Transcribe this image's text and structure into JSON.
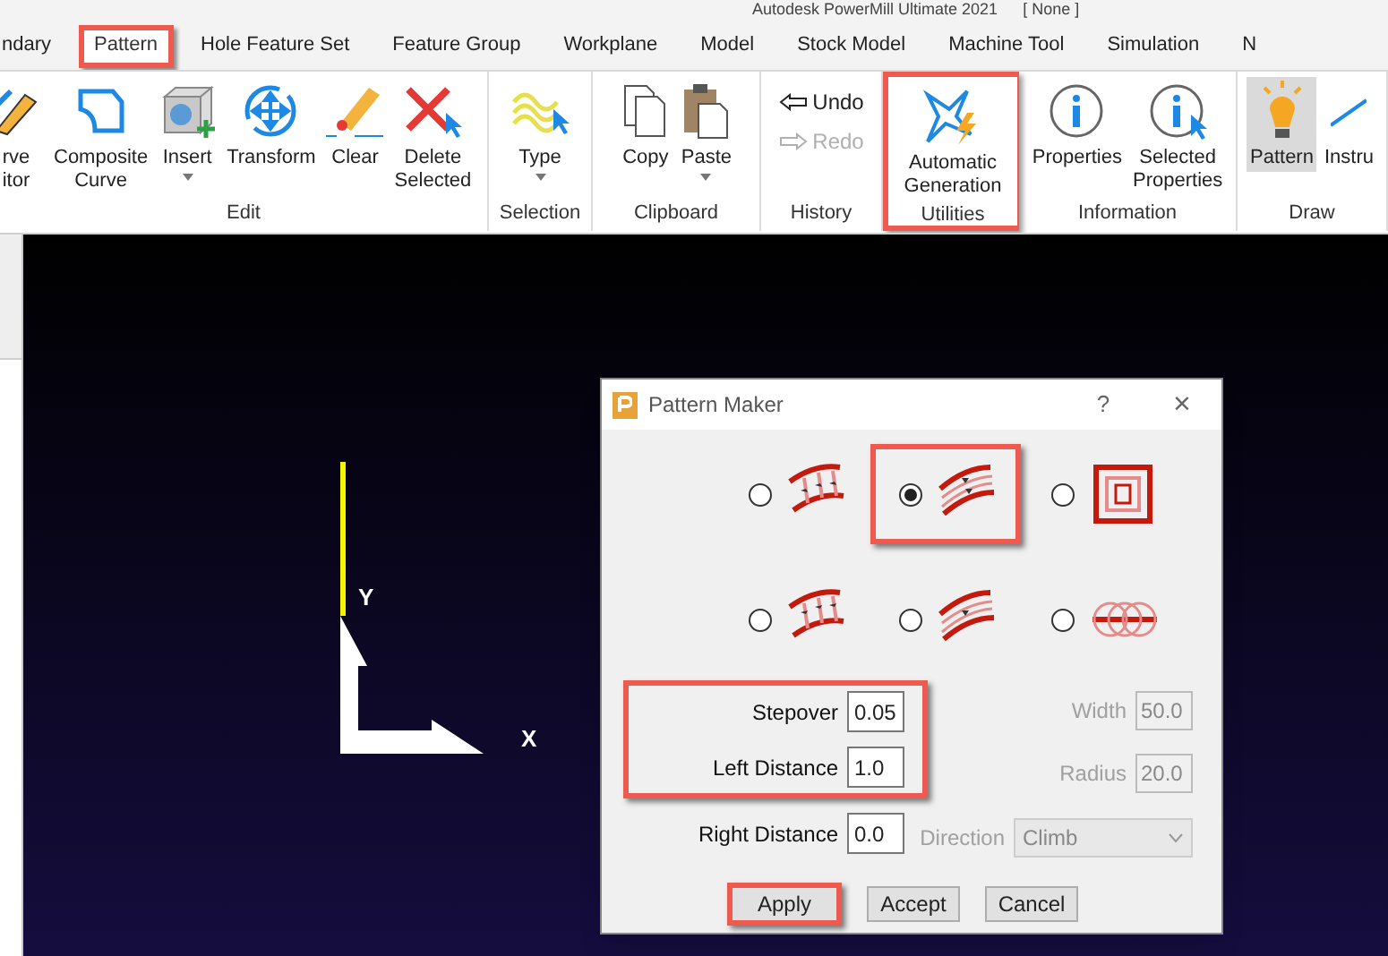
{
  "window": {
    "title": "Autodesk PowerMill Ultimate 2021",
    "project": "[   None ]"
  },
  "tabs": [
    {
      "label": "ndary",
      "selected": false,
      "highlighted": false
    },
    {
      "label": "Pattern",
      "selected": true,
      "highlighted": true
    },
    {
      "label": "Hole Feature Set",
      "selected": false,
      "highlighted": false
    },
    {
      "label": "Feature Group",
      "selected": false,
      "highlighted": false
    },
    {
      "label": "Workplane",
      "selected": false,
      "highlighted": false
    },
    {
      "label": "Model",
      "selected": false,
      "highlighted": false
    },
    {
      "label": "Stock Model",
      "selected": false,
      "highlighted": false
    },
    {
      "label": "Machine Tool",
      "selected": false,
      "highlighted": false
    },
    {
      "label": "Simulation",
      "selected": false,
      "highlighted": false
    },
    {
      "label": "N",
      "selected": false,
      "highlighted": false
    }
  ],
  "ribbon": [
    {
      "label": "Edit",
      "highlighted": false,
      "buttons": [
        {
          "kind": "large",
          "lines": [
            "rve",
            "itor"
          ],
          "dropdown": false,
          "selected": false
        },
        {
          "kind": "large",
          "lines": [
            "Composite",
            "Curve"
          ],
          "dropdown": false,
          "selected": false
        },
        {
          "kind": "large",
          "lines": [
            "Insert"
          ],
          "dropdown": true,
          "selected": false
        },
        {
          "kind": "large",
          "lines": [
            "Transform"
          ],
          "dropdown": false,
          "selected": false
        },
        {
          "kind": "large",
          "lines": [
            "Clear"
          ],
          "dropdown": false,
          "selected": false
        },
        {
          "kind": "large",
          "lines": [
            "Delete",
            "Selected"
          ],
          "dropdown": false,
          "selected": false
        }
      ]
    },
    {
      "label": "Selection",
      "highlighted": false,
      "buttons": [
        {
          "kind": "large",
          "lines": [
            "Type"
          ],
          "dropdown": true,
          "selected": false
        }
      ]
    },
    {
      "label": "Clipboard",
      "highlighted": false,
      "buttons": [
        {
          "kind": "large",
          "lines": [
            "Copy"
          ],
          "dropdown": false,
          "selected": false
        },
        {
          "kind": "large",
          "lines": [
            "Paste"
          ],
          "dropdown": true,
          "selected": false
        }
      ]
    },
    {
      "label": "History",
      "highlighted": false,
      "buttons": [
        {
          "kind": "small",
          "lines": [
            "Undo"
          ],
          "disabled": false
        },
        {
          "kind": "small",
          "lines": [
            "Redo"
          ],
          "disabled": true
        }
      ]
    },
    {
      "label": "Utilities",
      "highlighted": true,
      "buttons": [
        {
          "kind": "large",
          "lines": [
            "Automatic",
            "Generation"
          ],
          "dropdown": false,
          "selected": false
        }
      ]
    },
    {
      "label": "Information",
      "highlighted": false,
      "buttons": [
        {
          "kind": "large",
          "lines": [
            "Properties"
          ],
          "dropdown": false,
          "selected": false
        },
        {
          "kind": "large",
          "lines": [
            "Selected",
            "Properties"
          ],
          "dropdown": false,
          "selected": false
        }
      ]
    },
    {
      "label": "Draw",
      "highlighted": false,
      "buttons": [
        {
          "kind": "large",
          "lines": [
            "Pattern"
          ],
          "dropdown": false,
          "selected": true
        },
        {
          "kind": "large",
          "lines": [
            "Instru"
          ],
          "dropdown": false,
          "selected": false
        }
      ]
    }
  ],
  "viewport": {
    "axis_labels": [
      "Y",
      "X"
    ]
  },
  "dialog": {
    "title": "Pattern Maker",
    "help": "?",
    "close": "×",
    "patterns": [
      {
        "selected": false,
        "highlighted": false
      },
      {
        "selected": true,
        "highlighted": true
      },
      {
        "selected": false,
        "highlighted": false
      },
      {
        "selected": false,
        "highlighted": false
      },
      {
        "selected": false,
        "highlighted": false
      },
      {
        "selected": false,
        "highlighted": false
      }
    ],
    "left_groups": [
      {
        "highlighted": true,
        "fields": [
          {
            "label": "Stepover",
            "value": "0.05"
          },
          {
            "label": "Left Distance",
            "value": "1.0"
          }
        ]
      },
      {
        "highlighted": false,
        "fields": [
          {
            "label": "Right Distance",
            "value": "0.0"
          }
        ]
      }
    ],
    "right_fields": [
      {
        "kind": "text",
        "label": "Width",
        "value": "50.0",
        "disabled": true
      },
      {
        "kind": "text",
        "label": "Radius",
        "value": "20.0",
        "disabled": true
      },
      {
        "kind": "dropdown",
        "label": "Direction",
        "value": "Climb",
        "disabled": true
      }
    ],
    "buttons": [
      {
        "label": "Apply",
        "highlighted": true
      },
      {
        "label": "Accept",
        "highlighted": false
      },
      {
        "label": "Cancel",
        "highlighted": false
      }
    ]
  }
}
